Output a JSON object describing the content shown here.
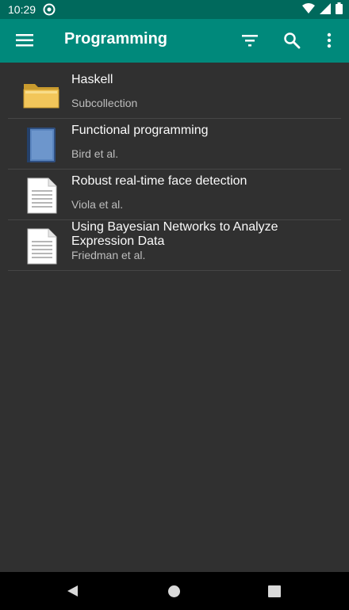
{
  "status": {
    "time": "10:29"
  },
  "app_bar": {
    "title": "Programming",
    "icons": [
      "menu-icon",
      "filter-icon",
      "search-icon",
      "more-vert-icon"
    ]
  },
  "items": [
    {
      "title": "Haskell",
      "subtitle": "Subcollection",
      "icon": "folder-icon"
    },
    {
      "title": "Functional programming",
      "subtitle": "Bird et al.",
      "icon": "book-icon"
    },
    {
      "title": "Robust real-time face detection",
      "subtitle": "Viola et al.",
      "icon": "document-icon"
    },
    {
      "title": "Using Bayesian Networks to Analyze Expression Data",
      "subtitle": "Friedman et al.",
      "icon": "document-icon"
    }
  ],
  "colors": {
    "app_bar": "#00897b",
    "status_bar": "#00695c",
    "background": "#303030"
  }
}
